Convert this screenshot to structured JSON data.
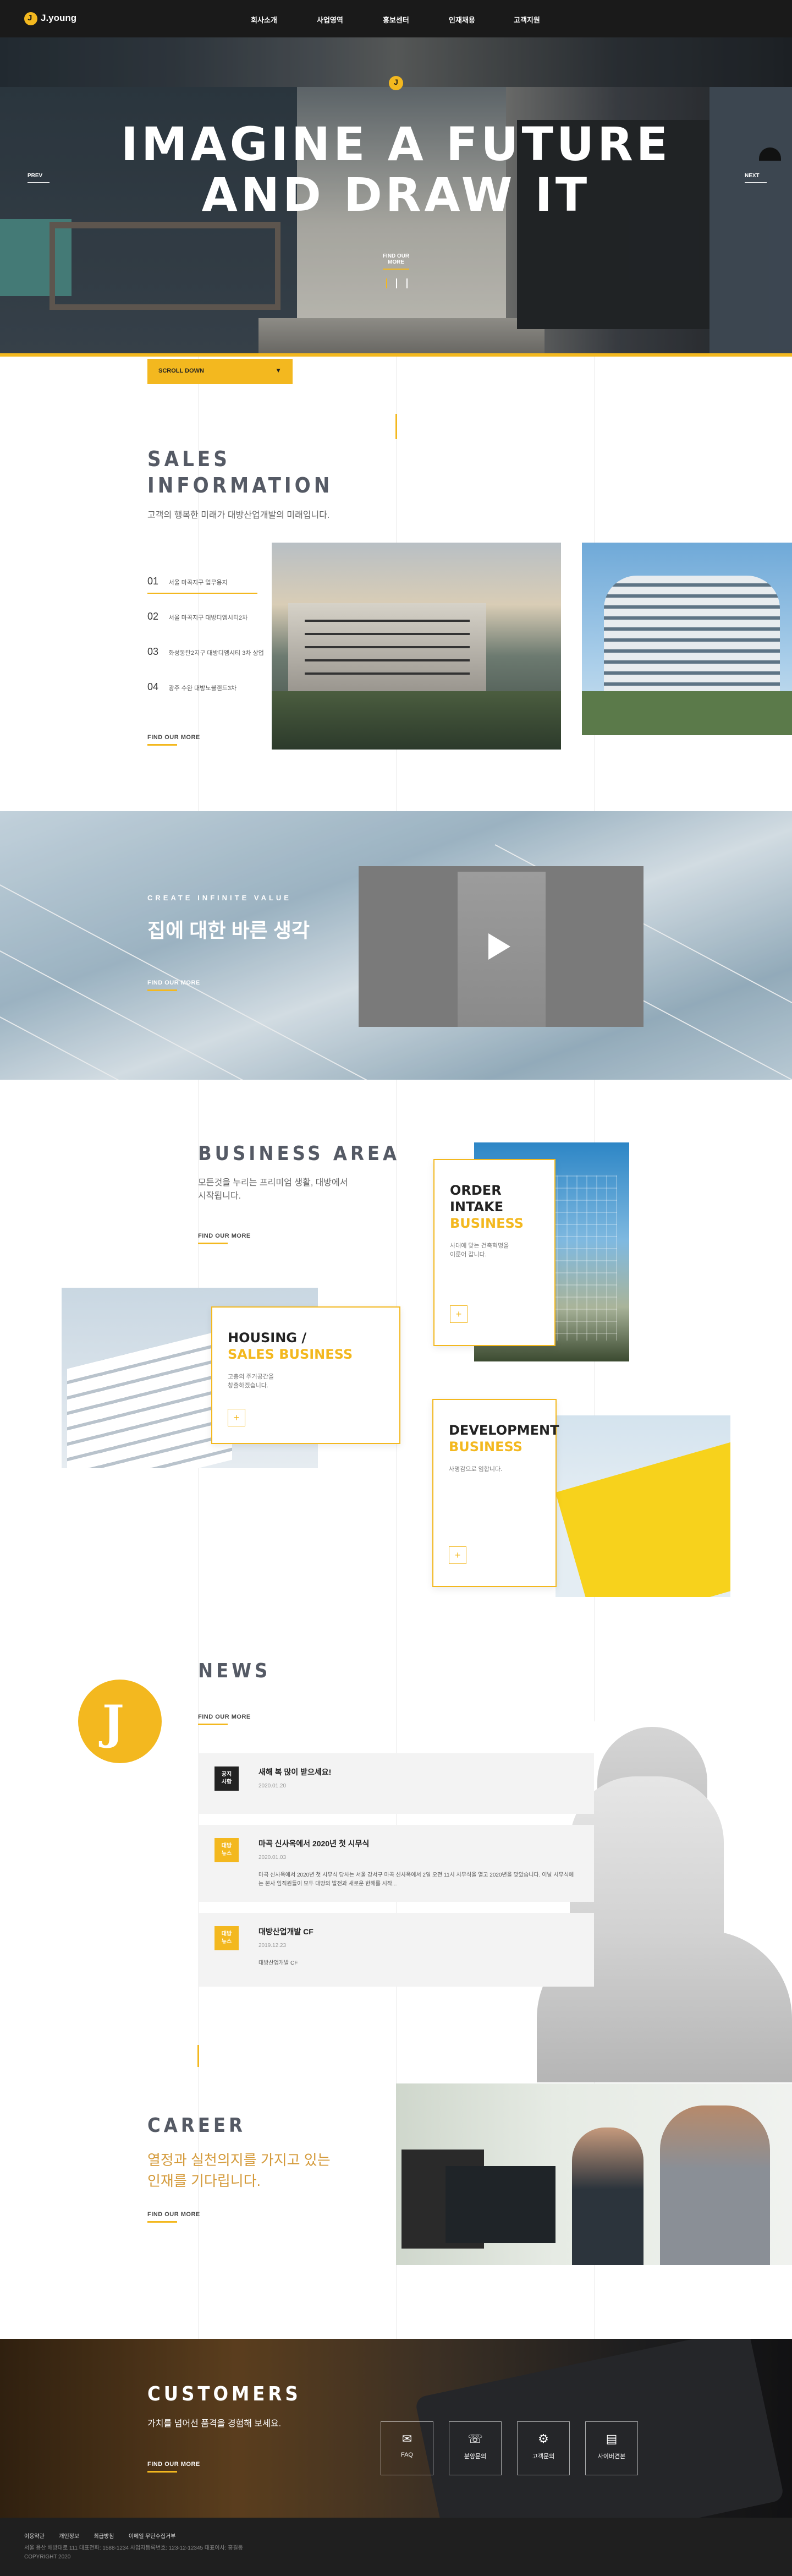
{
  "header": {
    "logo_text": "J.young",
    "nav": [
      "회사소개",
      "사업영역",
      "홍보센터",
      "인재채용",
      "고객지원"
    ]
  },
  "hero": {
    "line1": "IMAGINE A FUTURE",
    "line2": "AND DRAW IT",
    "find_more": "FIND OUR MORE",
    "prev": "PREV",
    "next": "NEXT",
    "scroll": "SCROLL DOWN"
  },
  "sales": {
    "title1": "SALES",
    "title2": "INFORMATION",
    "desc": "고객의 행복한 미래가 대방산업개발의 미래입니다.",
    "items": [
      {
        "num": "01",
        "label": "서울 마곡지구 업무용지"
      },
      {
        "num": "02",
        "label": "서울 마곡지구 대방디엠시티2차"
      },
      {
        "num": "03",
        "label": "화성동탄2지구 대방디엠시티 3차 상업"
      },
      {
        "num": "04",
        "label": "광주 수완 대방노블랜드3차"
      }
    ],
    "more": "FIND OUR MORE"
  },
  "video": {
    "eyebrow": "CREATE INFINITE VALUE",
    "headline": "집에 대한 바른 생각",
    "more": "FIND OUR MORE"
  },
  "business": {
    "title": "BUSINESS AREA",
    "desc1": "모든것을 누리는 프리미엄 생활, 대방에서",
    "desc2": "시작됩니다.",
    "more": "FIND OUR MORE",
    "cards": [
      {
        "title": "ORDER INTAKE",
        "sub": "BUSINESS",
        "desc": "사대에 맞는 건축혁명을\n이룬어 갑니다."
      },
      {
        "title": "HOUSING /",
        "sub": "SALES BUSINESS",
        "desc": "고층의 주거공간을\n창출하겠습니다."
      },
      {
        "title": "DEVELOPMENT",
        "sub": "BUSINESS",
        "desc": "사명감으로 임합니다."
      }
    ],
    "plus": "+"
  },
  "news": {
    "title": "NEWS",
    "more": "FIND OUR MORE",
    "items": [
      {
        "badge": "공지\n사항",
        "badge_color": "#222222",
        "title": "새해 복 많이 받으세요!",
        "date": "2020.01.20",
        "body": ""
      },
      {
        "badge": "대방\n뉴스",
        "badge_color": "#f3b81f",
        "title": "마곡 신사옥에서 2020년 첫 시무식",
        "date": "2020.01.03",
        "body": "마곡 신사옥에서 2020년 첫 시무식 당사는 서울 강서구 마곡 신사옥에서 2일 오전 11시 시무식을 열고 2020년을 맞았습니다. 이날 시무식에는 본사 임직원들이 모두 대방의 발전과 새로운 한해를 시작..."
      },
      {
        "badge": "대방\n뉴스",
        "badge_color": "#f3b81f",
        "title": "대방산업개발 CF",
        "date": "2019.12.23",
        "body": "대방산업개발 CF"
      }
    ]
  },
  "career": {
    "title": "CAREER",
    "line1": "열정과 실천의지를 가지고 있는",
    "line2": "인재를 기다립니다.",
    "more": "FIND OUR MORE"
  },
  "customers": {
    "title": "CUSTOMERS",
    "desc": "가치를 넘어선 품격을 경험해 보세요.",
    "more": "FIND OUR MORE",
    "icons": [
      {
        "icon": "chat-icon",
        "label": "FAQ"
      },
      {
        "icon": "phone-icon",
        "label": "분양문의"
      },
      {
        "icon": "gear-icon",
        "label": "고객문의"
      },
      {
        "icon": "document-icon",
        "label": "사이버견본"
      }
    ]
  },
  "footer": {
    "links": [
      "이용약관",
      "개인정보",
      "최급방침",
      "이메일 무단수집거부"
    ],
    "address": "서울 용산 해방대로 111   대표전화: 1588-1234   사업자등록번호: 123-12-12345   대표이사: 홍길동",
    "copyright": "COPYRIGHT 2020"
  },
  "colors": {
    "accent": "#f3b81f",
    "dark": "#1a1a1a"
  }
}
